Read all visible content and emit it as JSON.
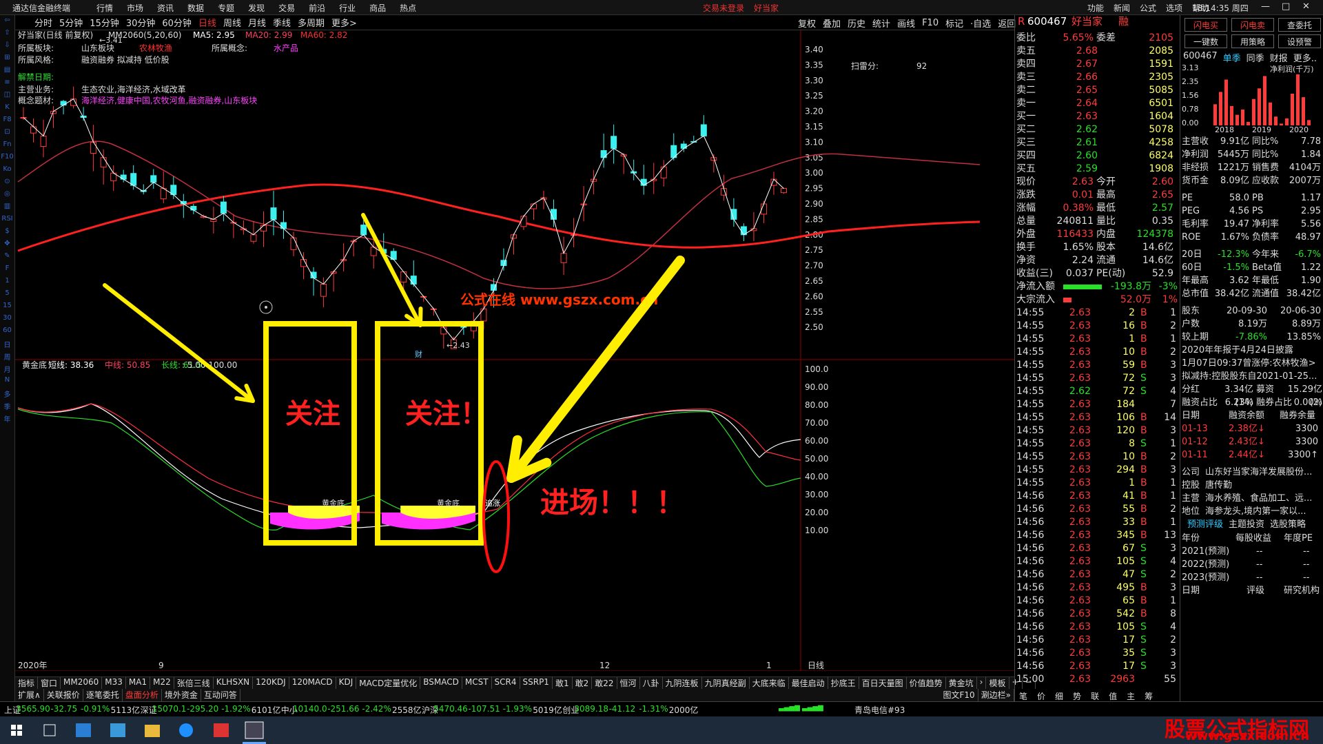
{
  "window": {
    "app_title": "通达信金融终端",
    "menu": [
      "行情",
      "市场",
      "资讯",
      "数据",
      "专题",
      "发现",
      "交易",
      "前沿",
      "行业",
      "商品",
      "热点"
    ],
    "status": [
      "交易未登录",
      "好当家"
    ],
    "right_menu": [
      "功能",
      "新闻",
      "公式",
      "选项",
      "帮助"
    ],
    "clock": "18:14:35 周四",
    "win_buttons": [
      "‹",
      "›",
      "▭",
      "▭",
      "—",
      "□",
      "✕"
    ]
  },
  "left_tools": [
    "⇦",
    "⇧",
    "⇩",
    "⊞",
    "▤",
    "≡",
    "◫",
    "K",
    "F8",
    "⊡",
    "Fn",
    "F10",
    "Ko",
    "⊙",
    "◎",
    "▥",
    "RSI",
    "$",
    "✥",
    "✎",
    "F",
    "1",
    "5",
    "15",
    "30",
    "60",
    "日",
    "周",
    "月",
    "N",
    "多",
    "季",
    "年"
  ],
  "periods": [
    "分时",
    "5分钟",
    "15分钟",
    "30分钟",
    "60分钟",
    "日线",
    "周线",
    "月线",
    "季线",
    "多周期",
    "更多>"
  ],
  "active_period": "日线",
  "tools": [
    "复权",
    "叠加",
    "历史",
    "统计",
    "画线",
    "F10",
    "标记",
    "·自选",
    "返回"
  ],
  "chart_header": {
    "name": "好当家(日线 前复权)",
    "ma_name": "MM2060(5,20,60)",
    "ma5": "MA5: 2.95",
    "ma20": "MA20: 2.99",
    "ma60": "MA60: 2.82"
  },
  "info": {
    "block_label": "所属板块:",
    "block": "山东板块",
    "block_tag": "农林牧渔",
    "style_label": "所属风格:",
    "style": "融资融券 拟减持 低价股",
    "concept_label": "所属概念:",
    "concept": "水产品",
    "unban_label": "解禁日期:",
    "business_label": "主营业务:",
    "business": "生态农业,海洋经济,水域改革",
    "theme_label": "概念题材:",
    "theme": "海洋经济,健康中国,农牧河鱼,融资融券,山东板块",
    "scan_label": "扫雷分:",
    "scan": "92"
  },
  "price_axis": [
    "3.40",
    "3.35",
    "3.30",
    "3.25",
    "3.20",
    "3.15",
    "3.10",
    "3.05",
    "3.00",
    "2.95",
    "2.90",
    "2.85",
    "2.80",
    "2.75",
    "2.70",
    "2.65",
    "2.60",
    "2.55",
    "2.50"
  ],
  "high_mark": "3.41",
  "low_mark": "2.43",
  "low_tag": "财",
  "watermark": "公式在线 www.gszx.com.cn",
  "indicator": {
    "name": "黄金底",
    "short": "短线: 38.36",
    "mid": "中线: 50.85",
    "long": "长线: 61.57",
    "range": ": 5.00  100.00",
    "axis": [
      "100.0",
      "90.00",
      "80.00",
      "70.00",
      "60.00",
      "50.00",
      "40.00",
      "30.00",
      "20.00",
      "10.00"
    ],
    "label1": "黄金底",
    "label2": "黄金底",
    "label3": "追涨"
  },
  "annotations": {
    "focus1": "关注",
    "focus2": "关注！",
    "enter": "进场！！！"
  },
  "date_axis": [
    "2020年",
    "9",
    "12",
    "1"
  ],
  "date_axis_right": "日线",
  "tabs_row1": [
    "指标",
    "窗口",
    "MM2060",
    "M33",
    "MA1",
    "M22",
    "张倍三线",
    "KLHSXN",
    "120KDJ",
    "120MACD",
    "KDJ",
    "MACD定量优化",
    "BSMACD",
    "MCST",
    "SCR4",
    "SSRP1",
    "敢1",
    "敢2",
    "敢22",
    "恒河",
    "八卦",
    "九阴连板",
    "九阴真经副",
    "大底来临",
    "最佳启动",
    "抄底王",
    "百日天量图",
    "价值趋势",
    "黄金坑",
    "›",
    "模板",
    "+",
    "−"
  ],
  "tabs_row2": [
    "扩展∧",
    "关联报价",
    "逐笔委托",
    "盘面分析",
    "境外资金",
    "互动问答"
  ],
  "tabs_row2_right": [
    "图文F10",
    "涮边栏»"
  ],
  "quote": {
    "code": "600467",
    "name": "好当家",
    "badge": "融",
    "weibi_label": "委比",
    "weibi": "5.65%",
    "weicha_label": "委差",
    "weicha": "2105",
    "asks": [
      [
        "卖五",
        "2.68",
        "2085"
      ],
      [
        "卖四",
        "2.67",
        "1591"
      ],
      [
        "卖三",
        "2.66",
        "2305"
      ],
      [
        "卖二",
        "2.65",
        "5085"
      ],
      [
        "卖一",
        "2.64",
        "6501"
      ]
    ],
    "bids": [
      [
        "买一",
        "2.63",
        "1604"
      ],
      [
        "买二",
        "2.62",
        "5078"
      ],
      [
        "买三",
        "2.61",
        "4258"
      ],
      [
        "买四",
        "2.60",
        "6824"
      ],
      [
        "买五",
        "2.59",
        "1908"
      ]
    ],
    "stats": [
      [
        "现价",
        "2.63",
        "今开",
        "2.60"
      ],
      [
        "涨跌",
        "0.01",
        "最高",
        "2.65"
      ],
      [
        "涨幅",
        "0.38%",
        "最低",
        "2.57"
      ],
      [
        "总量",
        "240811",
        "量比",
        "0.35"
      ],
      [
        "外盘",
        "116433",
        "内盘",
        "124378"
      ],
      [
        "换手",
        "1.65%",
        "股本",
        "14.6亿"
      ],
      [
        "净资",
        "2.24",
        "流通",
        "14.6亿"
      ],
      [
        "收益(三)",
        "0.037",
        "PE(动)",
        "52.9"
      ]
    ],
    "flow": [
      [
        "净流入额",
        "-193.8万",
        "-3%"
      ],
      [
        "大宗流入",
        "52.0万",
        "1%"
      ]
    ],
    "ticks": [
      [
        "14:55",
        "2.63",
        "2",
        "B",
        "1"
      ],
      [
        "14:55",
        "2.63",
        "16",
        "B",
        "2"
      ],
      [
        "14:55",
        "2.63",
        "1",
        "B",
        "1"
      ],
      [
        "14:55",
        "2.63",
        "10",
        "B",
        "2"
      ],
      [
        "14:55",
        "2.63",
        "59",
        "B",
        "3"
      ],
      [
        "14:55",
        "2.63",
        "72",
        "S",
        "3"
      ],
      [
        "14:55",
        "2.62",
        "72",
        "S",
        "4"
      ],
      [
        "14:55",
        "2.63",
        "184",
        "",
        "7"
      ],
      [
        "14:55",
        "2.63",
        "106",
        "B",
        "14"
      ],
      [
        "14:55",
        "2.63",
        "120",
        "B",
        "3"
      ],
      [
        "14:55",
        "2.63",
        "8",
        "S",
        "1"
      ],
      [
        "14:55",
        "2.63",
        "10",
        "B",
        "2"
      ],
      [
        "14:55",
        "2.63",
        "294",
        "B",
        "3"
      ],
      [
        "14:55",
        "2.63",
        "1",
        "B",
        "1"
      ],
      [
        "14:56",
        "2.63",
        "41",
        "B",
        "1"
      ],
      [
        "14:56",
        "2.63",
        "55",
        "B",
        "2"
      ],
      [
        "14:56",
        "2.63",
        "33",
        "B",
        "1"
      ],
      [
        "14:56",
        "2.63",
        "345",
        "B",
        "13"
      ],
      [
        "14:56",
        "2.63",
        "67",
        "S",
        "3"
      ],
      [
        "14:56",
        "2.63",
        "105",
        "S",
        "4"
      ],
      [
        "14:56",
        "2.63",
        "47",
        "S",
        "2"
      ],
      [
        "14:56",
        "2.63",
        "495",
        "B",
        "3"
      ],
      [
        "14:56",
        "2.63",
        "65",
        "B",
        "1"
      ],
      [
        "14:56",
        "2.63",
        "542",
        "B",
        "8"
      ],
      [
        "14:56",
        "2.63",
        "105",
        "S",
        "4"
      ],
      [
        "14:56",
        "2.63",
        "17",
        "S",
        "2"
      ],
      [
        "14:56",
        "2.63",
        "35",
        "S",
        "3"
      ],
      [
        "14:56",
        "2.63",
        "17",
        "S",
        "3"
      ],
      [
        "15:00",
        "2.63",
        "2963",
        "",
        "55"
      ]
    ],
    "bottom_tabs": [
      "笔",
      "价",
      "细",
      "势",
      "联",
      "值",
      "主",
      "筹"
    ]
  },
  "fpanel": {
    "buttons": [
      "闪电买",
      "闪电卖",
      "查委托",
      "一键数",
      "用策略",
      "设预警"
    ],
    "code": "600467",
    "tabs": [
      "单季",
      "同季",
      "财报",
      "更多.."
    ],
    "active_tab": "单季",
    "chart_label": "净利润(千万)",
    "y_axis": [
      "3.13",
      "2.35",
      "1.56",
      "0.78",
      "0.00"
    ],
    "years": [
      "2018",
      "2019",
      "2020"
    ],
    "bars": [
      1.2,
      1.9,
      2.6,
      1.1,
      0.6,
      0.9,
      0.2,
      1.5,
      2.1,
      2.8,
      1.3,
      0.5,
      0.1,
      0.4,
      1.8,
      2.9,
      1.6,
      0.3
    ],
    "metrics": [
      [
        "主营收",
        "9.91亿",
        "同比%",
        "7.78"
      ],
      [
        "净利润",
        "5445万",
        "同比%",
        "1.84"
      ],
      [
        "非经损",
        "1221万",
        "销售费",
        "4104万"
      ],
      [
        "货币金",
        "8.09亿",
        "应收款",
        "2007万"
      ]
    ],
    "valuation": [
      [
        "PE",
        "58.0",
        "PB",
        "1.17"
      ],
      [
        "PEG",
        "4.56",
        "PS",
        "2.95"
      ],
      [
        "毛利率",
        "19.47",
        "净利率",
        "5.56"
      ],
      [
        "ROE",
        "1.67%",
        "负债率",
        "48.97"
      ]
    ],
    "perf": [
      [
        "20日",
        "-12.3%",
        "今年来",
        "-6.7%"
      ],
      [
        "60日",
        "-1.5%",
        "Beta值",
        "1.22"
      ],
      [
        "年最高",
        "3.62",
        "年最低",
        "1.90"
      ],
      [
        "总市值",
        "38.42亿",
        "流通值",
        "38.42亿"
      ]
    ],
    "holders_head": [
      "股东",
      "20-09-30",
      "20-06-30"
    ],
    "holders": [
      [
        "户数",
        "8.19万",
        "8.89万"
      ],
      [
        "较上期",
        "-7.86%",
        "13.85%"
      ]
    ],
    "notes": [
      "2020年年报于4月24日披露",
      "1月07日09:37曾涨停:农林牧渔>",
      "拟减持:控股股东自2021-01-25..."
    ],
    "fin": [
      [
        "分红",
        "3.34亿(14)",
        "募资",
        "15.29亿(2)"
      ],
      [
        "融资占比",
        "6.23%",
        "融券占比",
        "0.00%"
      ]
    ],
    "margin_head": [
      "日期",
      "融资余额",
      "融券余量"
    ],
    "margin": [
      [
        "01-13",
        "2.38亿↓",
        "3300"
      ],
      [
        "01-12",
        "2.43亿↓",
        "3300"
      ],
      [
        "01-11",
        "2.44亿↓",
        "3300↑"
      ]
    ],
    "company": [
      [
        "公司",
        "山东好当家海洋发展股份..."
      ],
      [
        "控股",
        "唐传勤"
      ],
      [
        "主营",
        "海水养殖、食品加工、远..."
      ],
      [
        "地位",
        "海参龙头,境内第一家以..."
      ]
    ],
    "links": [
      "预测评级",
      "主题投资",
      "选股策略"
    ],
    "forecast_head": [
      "年份",
      "每股收益",
      "年度PE"
    ],
    "forecast": [
      [
        "2021(预测)",
        "--",
        "--"
      ],
      [
        "2022(预测)",
        "--",
        "--"
      ],
      [
        "2023(预测)",
        "--",
        "--"
      ]
    ],
    "rating": [
      "日期",
      "评级",
      "研究机构"
    ]
  },
  "index_bar": [
    {
      "name": "上证",
      "val": "3565.90",
      "chg": "-32.75",
      "pct": "-0.91%",
      "amt": "5113亿"
    },
    {
      "name": "深证",
      "val": "15070.1",
      "chg": "-295.20",
      "pct": "-1.92%",
      "amt": "6101亿"
    },
    {
      "name": "中小",
      "val": "10140.0",
      "chg": "-251.66",
      "pct": "-2.42%",
      "amt": "2558亿"
    },
    {
      "name": "沪深",
      "val": "5470.46",
      "chg": "-107.51",
      "pct": "-1.93%",
      "amt": "5019亿"
    },
    {
      "name": "创业",
      "val": "3089.18",
      "chg": "-41.12",
      "pct": "-1.31%",
      "amt": "2000亿"
    }
  ],
  "index_extra": "青岛电信#93",
  "site_watermark_a": "股票公式指标网",
  "site_watermark_b": "www.gszx.com.cn",
  "colors": {
    "up": "#ff3b3b",
    "down": "#3cf0f0",
    "ma5": "#ffffff",
    "ma20": "#d04050",
    "ma60": "#ff2020",
    "annot": "#ffee00"
  }
}
